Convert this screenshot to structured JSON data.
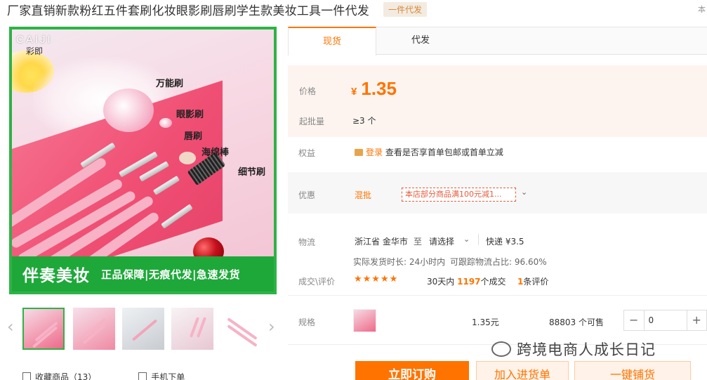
{
  "title": {
    "text": "厂家直销新款粉红五件套刷化妆眼影刷唇刷学生款美妆工具一件代发",
    "tag": "一件代发",
    "right_text": "本"
  },
  "main_image": {
    "logo": "CAIJI",
    "logo_sub": "彩即",
    "labels": [
      "万能刷",
      "眼影刷",
      "唇刷",
      "海绵棒",
      "细节刷"
    ],
    "banner_big": "伴奏美妆",
    "banner_small": "正品保障|无痕代发|急速发货"
  },
  "thumbnails": {
    "prev_icon": "‹",
    "next_icon": "›",
    "count": 5,
    "active_index": 0
  },
  "links": {
    "favorite": "收藏商品（13）",
    "mobile_order": "手机下单"
  },
  "tabs": [
    "现货",
    "代发"
  ],
  "price": {
    "label": "价格",
    "currency": "¥",
    "value": "1.35",
    "min_label": "起批量",
    "min_value": "≥3 个"
  },
  "benefits": {
    "label": "权益",
    "login_text": "登录",
    "desc": "查看是否享首单包邮或首单立减"
  },
  "promo": {
    "label": "优惠",
    "tag": "混批",
    "coupon": "本店部分商品满100元减1...",
    "chevron": "⌄"
  },
  "logistics": {
    "label": "物流",
    "from": "浙江省 金华市",
    "to_word": "至",
    "select": "请选择",
    "express": "快递 ¥3.5",
    "ship_time": "实际发货时长: 24小时内",
    "trace_rate": "可跟踪物流占比: 96.60%"
  },
  "deals": {
    "label": "成交\\评价",
    "stars": "★★★★★",
    "deals_prefix": "30天内",
    "deals_count": "1197",
    "deals_suffix": "个成交",
    "reviews_count": "1",
    "reviews_suffix": "条评价"
  },
  "spec": {
    "label": "规格",
    "price": "1.35元",
    "stock": "88803 个可售",
    "minus": "−",
    "plus": "+",
    "quantity": "0"
  },
  "actions": {
    "buy": "立即订购",
    "cart": "加入进货单",
    "share": "一键铺货"
  },
  "watermark": "跨境电商人成长日记",
  "colors": {
    "accent": "#ff7300",
    "green": "#2db345",
    "price_bg": "#fdf4ef"
  }
}
